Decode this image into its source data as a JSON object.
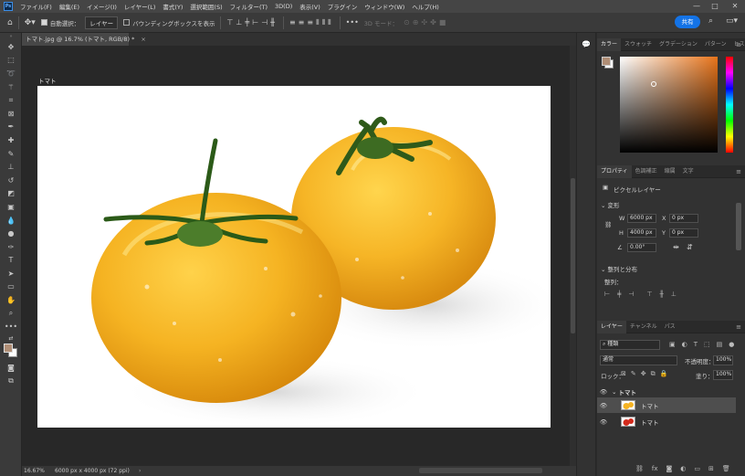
{
  "app": {
    "logo": "Ps"
  },
  "menu": [
    "ファイル(F)",
    "編集(E)",
    "イメージ(I)",
    "レイヤー(L)",
    "書式(Y)",
    "選択範囲(S)",
    "フィルター(T)",
    "3D(D)",
    "表示(V)",
    "プラグイン",
    "ウィンドウ(W)",
    "ヘルプ(H)"
  ],
  "window_controls": {
    "minimize": "—",
    "maximize": "□",
    "close": "✕"
  },
  "options": {
    "auto_select_label": "自動選択：",
    "auto_select_value": "レイヤー",
    "bounding_box_label": "バウンディングボックスを表示",
    "mode_3d_label": "3D モード：",
    "share_label": "共有"
  },
  "document": {
    "tab_title": "トマト.jpg @ 16.7% (トマト, RGB/8) *",
    "artboard_label": "トマト",
    "zoom": "16.67%",
    "size_info": "6000 px x 4000 px (72 ppi)"
  },
  "colors": {
    "foreground": "#b08e76",
    "background": "#ffffff",
    "accent": "#1473e6"
  },
  "color_panel": {
    "tabs": [
      "カラー",
      "スウォッチ",
      "グラデーション",
      "パターン",
      "ヒストリー"
    ]
  },
  "properties_panel": {
    "tabs": [
      "プロパティ",
      "色調補正",
      "縮属",
      "文字"
    ],
    "pixel_layer_label": "ピクセルレイヤー",
    "transform_section": "変形",
    "w_label": "W",
    "w_value": "6000 px",
    "h_label": "H",
    "h_value": "4000 px",
    "x_label": "X",
    "x_value": "0 px",
    "y_label": "Y",
    "y_value": "0 px",
    "angle_value": "0.00°",
    "align_section": "整列と分布",
    "align_label": "整列："
  },
  "layers_panel": {
    "tabs": [
      "レイヤー",
      "チャンネル",
      "パス"
    ],
    "filter_kind": "種類",
    "blend_mode": "通常",
    "opacity_label": "不透明度：",
    "opacity_value": "100%",
    "lock_label": "ロック：",
    "fill_label": "塗り：",
    "fill_value": "100%",
    "group_name": "トマト",
    "layers": [
      {
        "name": "トマト",
        "thumb": "yellow tomatoes",
        "selected": true
      },
      {
        "name": "トマト",
        "thumb": "red tomatoes",
        "selected": false
      }
    ]
  }
}
